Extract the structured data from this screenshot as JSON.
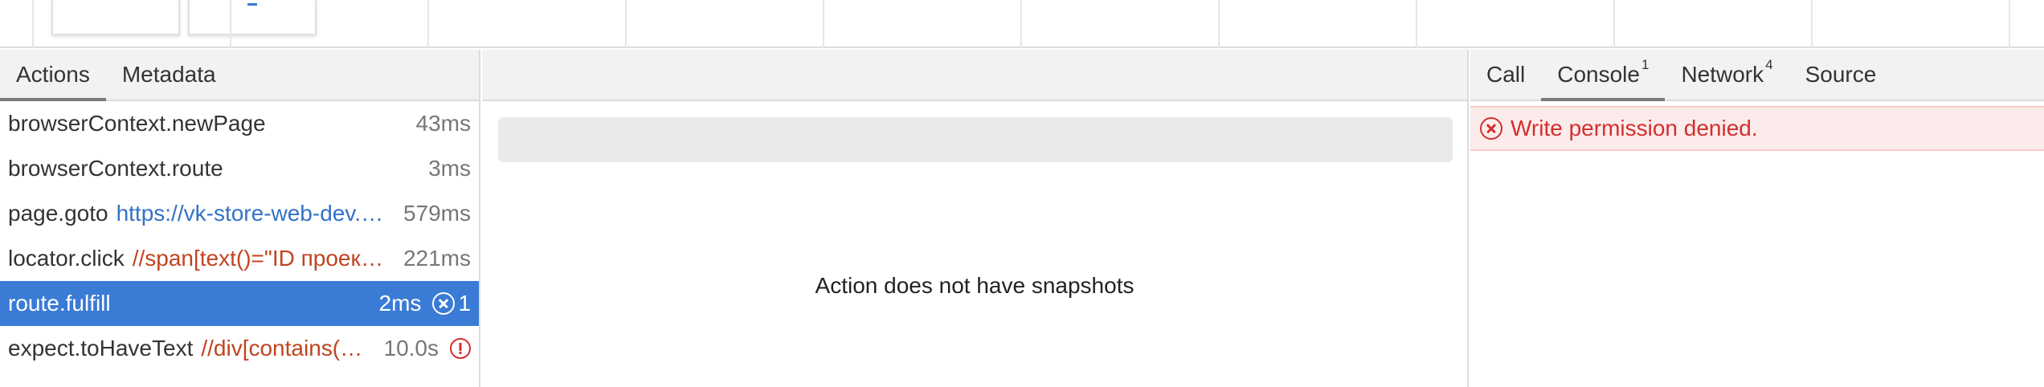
{
  "left_tabs": [
    {
      "label": "Actions",
      "selected": true
    },
    {
      "label": "Metadata",
      "selected": false
    }
  ],
  "actions": [
    {
      "title": "browserContext.newPage",
      "param": "",
      "time": "43ms"
    },
    {
      "title": "browserContext.route",
      "param": "",
      "time": "3ms"
    },
    {
      "title": "page.goto",
      "param": "https://vk-store-web-dev.example/",
      "param_kind": "url",
      "time": "579ms"
    },
    {
      "title": "locator.click",
      "param": "//span[text()=\"ID проекта\"]",
      "param_kind": "locator",
      "time": "221ms"
    },
    {
      "title": "route.fulfill",
      "param": "",
      "time": "2ms",
      "error_count": "1",
      "selected": true
    },
    {
      "title": "expect.toHaveText",
      "param": "//div[contains(@class,\"ErrorText\")]",
      "param_kind": "locator",
      "time": "10.0s",
      "status_icon": "warning-circle-icon"
    }
  ],
  "center": {
    "empty_message": "Action does not have snapshots"
  },
  "right_tabs": [
    {
      "label": "Call",
      "count": "",
      "selected": false
    },
    {
      "label": "Console",
      "count": "1",
      "selected": true
    },
    {
      "label": "Network",
      "count": "4",
      "selected": false
    },
    {
      "label": "Source",
      "count": "",
      "selected": false
    }
  ],
  "console": {
    "messages": [
      {
        "level": "error",
        "text": "Write permission denied.",
        "icon": "error-circle-icon"
      }
    ]
  },
  "colors": {
    "selected_row": "#3a7bd5",
    "url_param": "#3272c7",
    "locator_param": "#c1441f",
    "error": "#d32f2f",
    "error_bg": "#fcebeb"
  }
}
